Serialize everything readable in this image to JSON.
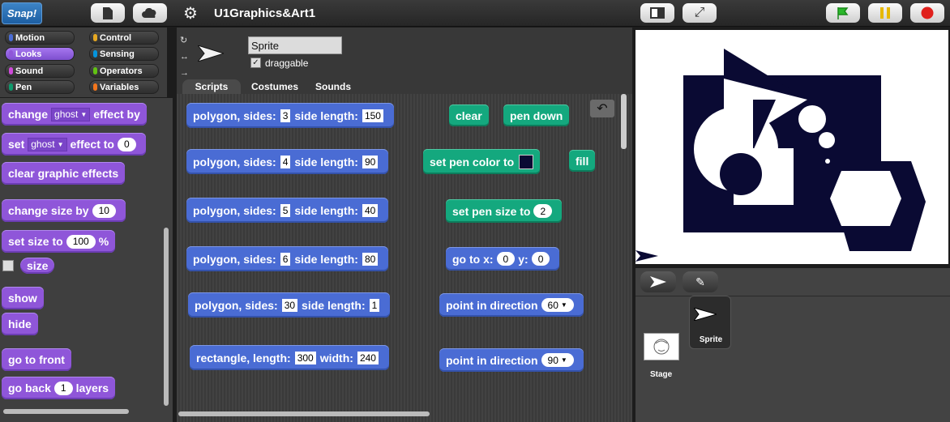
{
  "topbar": {
    "logo": "Snap!",
    "project_title": "U1Graphics&Art1",
    "colors": {
      "green_flag": "#2bb82b",
      "pause": "#e6b800",
      "stop": "#e0201c"
    }
  },
  "categories": [
    {
      "label": "Motion",
      "color": "#4a6cd4"
    },
    {
      "label": "Control",
      "color": "#e6a822"
    },
    {
      "label": "Looks",
      "color": "#8f56d9"
    },
    {
      "label": "Sensing",
      "color": "#0494dc"
    },
    {
      "label": "Sound",
      "color": "#cf4ad9"
    },
    {
      "label": "Operators",
      "color": "#62c213"
    },
    {
      "label": "Pen",
      "color": "#0e9a6c"
    },
    {
      "label": "Variables",
      "color": "#f3761d"
    }
  ],
  "palette": {
    "change_effect": {
      "label1": "change",
      "effect": "ghost",
      "label2": "effect by"
    },
    "set_effect": {
      "label1": "set",
      "effect": "ghost",
      "label2": "effect to",
      "value": "0"
    },
    "clear_effects": "clear graphic effects",
    "change_size": {
      "label": "change size by",
      "value": "10"
    },
    "set_size": {
      "label": "set size to",
      "value": "100",
      "unit": "%"
    },
    "size_reporter": "size",
    "show": "show",
    "hide": "hide",
    "go_front": "go to front",
    "go_back": {
      "label1": "go back",
      "value": "1",
      "label2": "layers"
    }
  },
  "sprite": {
    "name": "Sprite",
    "draggable_label": "draggable",
    "draggable_check": "✓",
    "rotation_icons": [
      "↻",
      "↔",
      "→"
    ]
  },
  "tabs": [
    "Scripts",
    "Costumes",
    "Sounds"
  ],
  "scripts": {
    "polygon_label": "polygon, sides:",
    "side_length_label": "side length:",
    "polygons": [
      {
        "sides": "3",
        "length": "150"
      },
      {
        "sides": "4",
        "length": "90"
      },
      {
        "sides": "5",
        "length": "40"
      },
      {
        "sides": "6",
        "length": "80"
      },
      {
        "sides": "30",
        "length": "1"
      }
    ],
    "rectangle": {
      "label1": "rectangle, length:",
      "length": "300",
      "label2": "width:",
      "width": "240"
    },
    "clear": "clear",
    "pen_down": "pen down",
    "set_pen_color": "set pen color to",
    "fill": "fill",
    "set_pen_size": {
      "label": "set pen size to",
      "value": "2"
    },
    "go_to": {
      "label_x": "go to x:",
      "x": "0",
      "label_y": "y:",
      "y": "0"
    },
    "point_dir_1": {
      "label": "point in direction",
      "value": "60"
    },
    "point_dir_2": {
      "label": "point in direction",
      "value": "90"
    }
  },
  "corral": {
    "stage_label": "Stage",
    "sprite_label": "Sprite"
  }
}
